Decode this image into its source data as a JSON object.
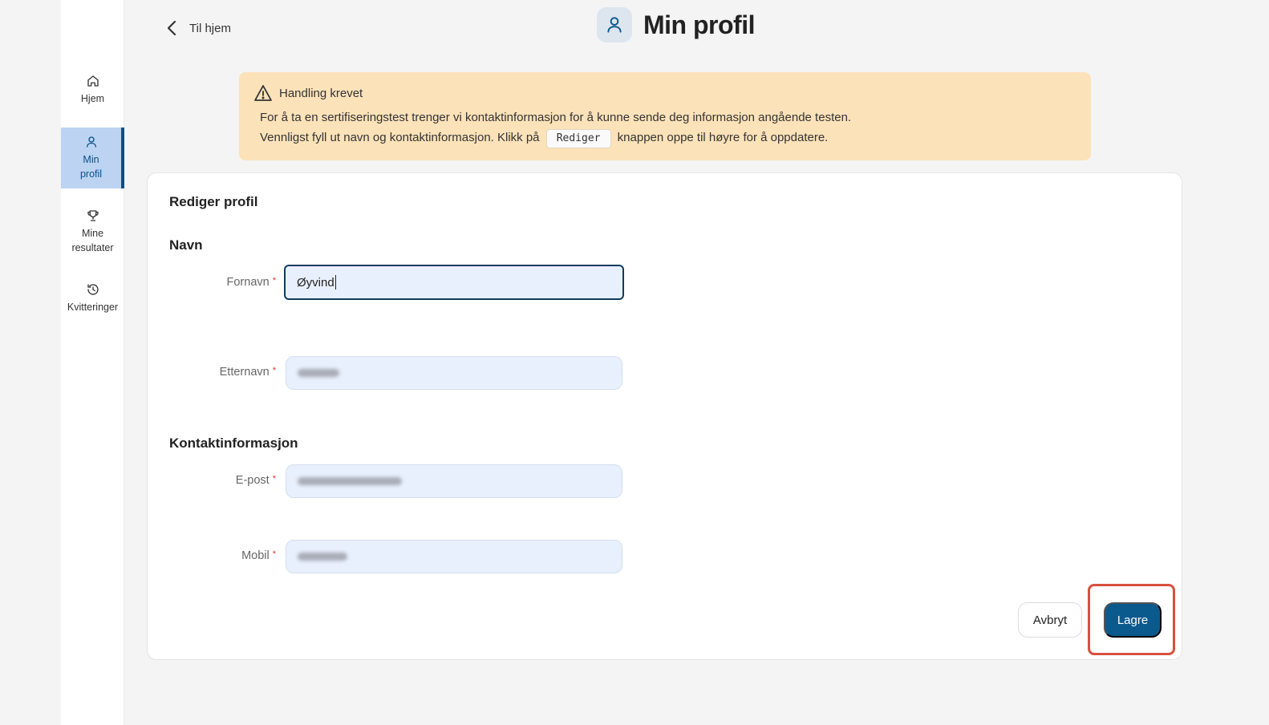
{
  "sidebar": {
    "items": [
      {
        "label": "Hjem",
        "icon": "home-icon"
      },
      {
        "label": "Min profil",
        "icon": "user-icon",
        "active": true
      },
      {
        "label": "Mine resultater",
        "icon": "trophy-icon"
      },
      {
        "label": "Kvitteringer",
        "icon": "history-icon"
      }
    ]
  },
  "header": {
    "back_label": "Til hjem",
    "title": "Min profil"
  },
  "alert": {
    "title": "Handling krevet",
    "line1": "For å ta en sertifiseringstest trenger vi kontaktinformasjon for å kunne sende deg informasjon angående testen.",
    "line2_before": "Vennligst fyll ut navn og kontaktinformasjon. Klikk på",
    "code": "Rediger",
    "line2_after": "knappen oppe til høyre for å oppdatere."
  },
  "form": {
    "title": "Rediger profil",
    "section_name": "Navn",
    "section_contact": "Kontaktinformasjon",
    "required_marker": "*",
    "fields": {
      "first_name": {
        "label": "Fornavn",
        "value": "Øyvind"
      },
      "last_name": {
        "label": "Etternavn"
      },
      "email": {
        "label": "E-post"
      },
      "mobile": {
        "label": "Mobil"
      }
    },
    "cancel_label": "Avbryt",
    "save_label": "Lagre"
  },
  "colors": {
    "accent": "#0b5a8e",
    "active_nav_bg": "#bcd4f1",
    "alert_bg": "#fce2b9",
    "highlight": "#d9503f"
  }
}
